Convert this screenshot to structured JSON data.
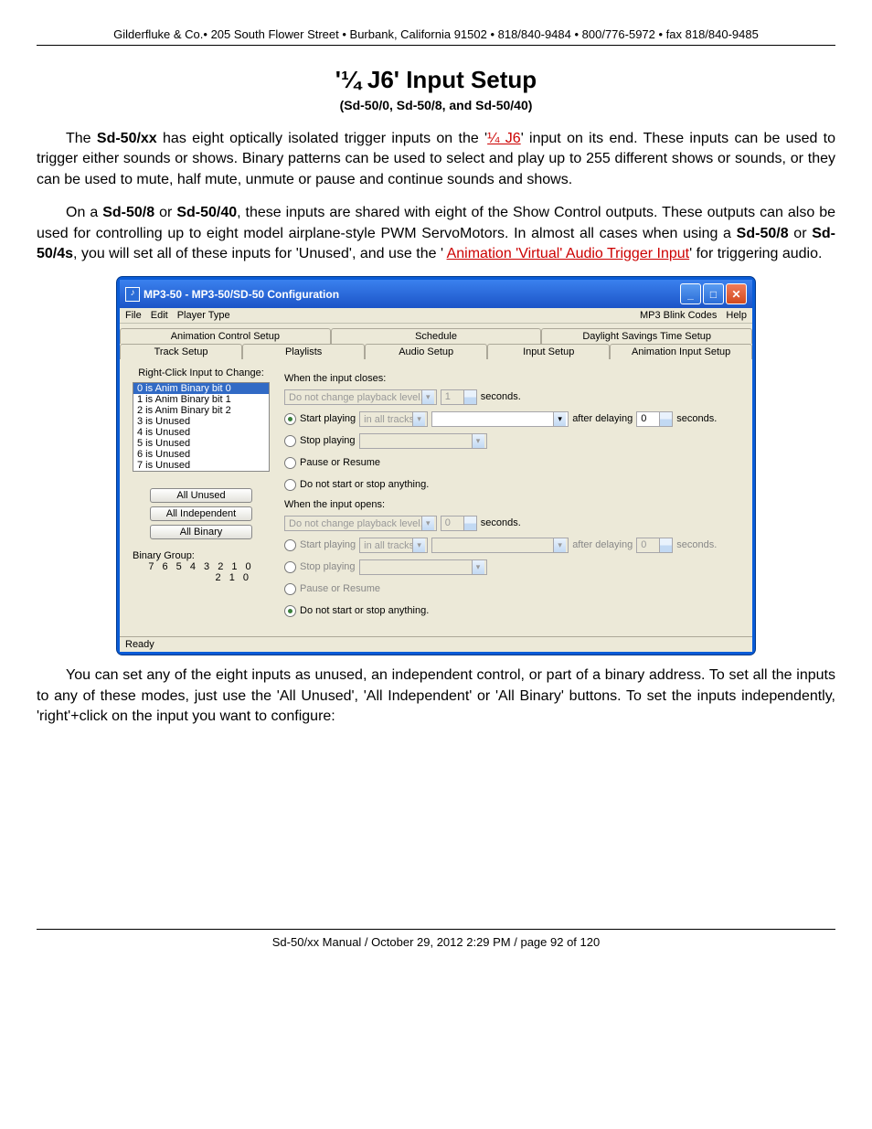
{
  "header": "Gilderfluke & Co.• 205 South Flower Street • Burbank, California 91502 • 818/840-9484 • 800/776-5972 • fax 818/840-9485",
  "title": "'¼ J6' Input Setup",
  "subtitle": "(Sd-50/0, Sd-50/8, and Sd-50/40)",
  "para1_a": "The ",
  "para1_b": "Sd-50/xx",
  "para1_c": " has eight optically isolated trigger inputs on the '",
  "para1_link1": "¼ J6",
  "para1_d": "' input on its end. These inputs can be used to trigger either sounds or shows. Binary patterns can be used to select and play up to 255 different shows or sounds, or they can be used to mute, half mute, unmute or pause and continue sounds and shows.",
  "para2_a": "On a ",
  "para2_b": "Sd-50/8",
  "para2_c": " or ",
  "para2_d": "Sd-50/40",
  "para2_e": ", these inputs are shared with eight of the Show Control outputs. These outputs can also be used for controlling up to eight model airplane-style PWM ServoMotors. In almost all cases when using a ",
  "para2_f": "Sd-50/8",
  "para2_g": " or ",
  "para2_h": "Sd-50/4s",
  "para2_i": ", you will set all of these inputs for 'Unused', and use the ' ",
  "para2_link": "Animation 'Virtual' Audio Trigger Input",
  "para2_j": "' for triggering audio.",
  "para3": "You can set any of the eight inputs as unused, an independent control, or part of a binary address. To set all the inputs to any of these modes, just use the 'All Unused', 'All Independent' or 'All Binary' buttons. To set the inputs independently, 'right'+click on the input you want to configure:",
  "footer": "Sd-50/xx Manual / October 29, 2012 2:29 PM / page 92 of 120",
  "win": {
    "title": "MP3-50 - MP3-50/SD-50 Configuration",
    "menu": {
      "file": "File",
      "edit": "Edit",
      "player": "Player Type",
      "codes": "MP3 Blink Codes",
      "help": "Help"
    },
    "tabs_row1": [
      "Animation Control Setup",
      "Schedule",
      "Daylight Savings Time Setup"
    ],
    "tabs_row2": [
      "Track Setup",
      "Playlists",
      "Audio Setup",
      "Input Setup",
      "Animation Input Setup"
    ],
    "left": {
      "label": "Right-Click Input to Change:",
      "items": [
        "0 is Anim Binary bit 0",
        "1 is Anim Binary bit 1",
        "2 is Anim Binary bit 2",
        "3 is Unused",
        "4 is Unused",
        "5 is Unused",
        "6 is Unused",
        "7 is Unused"
      ],
      "btns": [
        "All Unused",
        "All Independent",
        "All Binary"
      ],
      "bg_label": "Binary Group:",
      "bg1": "7 6 5 4 3 2 1 0",
      "bg2": "2 1 0"
    },
    "right": {
      "closes": "When the input closes:",
      "opens": "When the input opens:",
      "playback": "Do not change playback level.",
      "seconds": "seconds.",
      "start": "Start playing",
      "inall": "in all tracks",
      "after": "after delaying",
      "stop": "Stop playing",
      "pause": "Pause or Resume",
      "donot": "Do not start or stop anything.",
      "val1": "1",
      "val0": "0"
    },
    "status": "Ready"
  }
}
